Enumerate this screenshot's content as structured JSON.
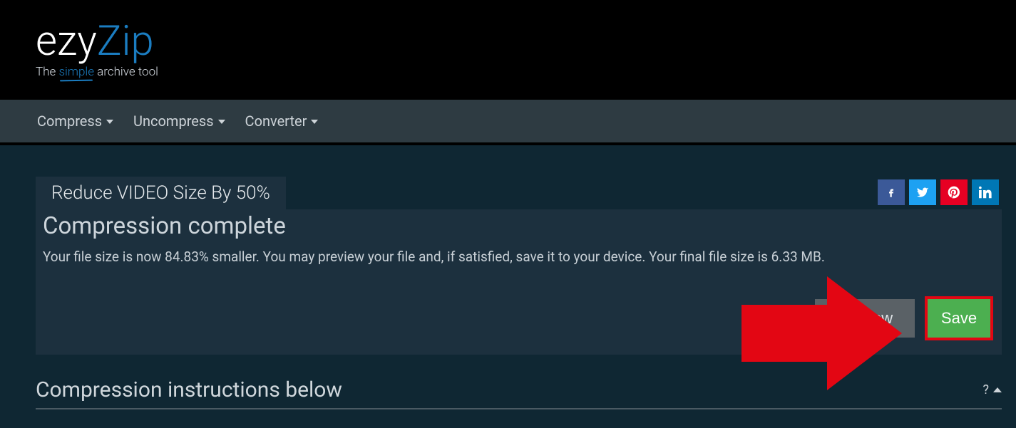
{
  "logo": {
    "part1": "ezy",
    "part2": "Zip",
    "tagline_pre": "The ",
    "tagline_mid": "simple",
    "tagline_post": " archive tool"
  },
  "nav": {
    "compress": "Compress",
    "uncompress": "Uncompress",
    "converter": "Converter"
  },
  "page_title": "Reduce VIDEO Size By 50%",
  "panel": {
    "heading": "Compression complete",
    "body": "Your file size is now 84.83% smaller. You may preview your file and, if satisfied, save it to your device. Your final file size is 6.33 MB.",
    "preview_label": "Preview",
    "save_label": "Save"
  },
  "instructions_title": "Compression instructions below",
  "help_label": "?"
}
